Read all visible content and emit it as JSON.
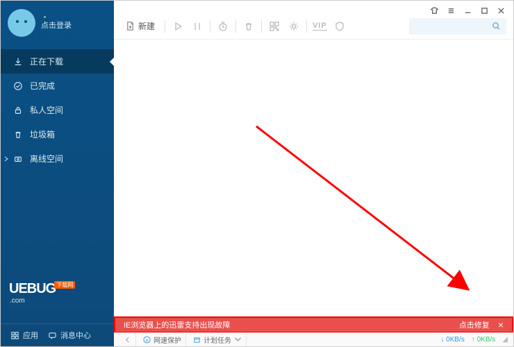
{
  "profile": {
    "login_text": "点击登录"
  },
  "sidebar": {
    "items": [
      {
        "label": "正在下载"
      },
      {
        "label": "已完成"
      },
      {
        "label": "私人空间"
      },
      {
        "label": "垃圾箱"
      },
      {
        "label": "离线空间"
      }
    ]
  },
  "bottom": {
    "apps": "应用",
    "msgs": "消息中心"
  },
  "logo": {
    "brand": "UEBUG",
    "tag": "下载网",
    "suffix": ".com"
  },
  "toolbar": {
    "new_label": "新建",
    "vip": "VIP"
  },
  "error": {
    "message": "IE浏览器上的迅雷支持出现故障",
    "repair": "点击修复"
  },
  "status": {
    "net_protect": "网速保护",
    "plan_task": "计划任务",
    "down": "0KB/s",
    "up": "0KB/s"
  }
}
